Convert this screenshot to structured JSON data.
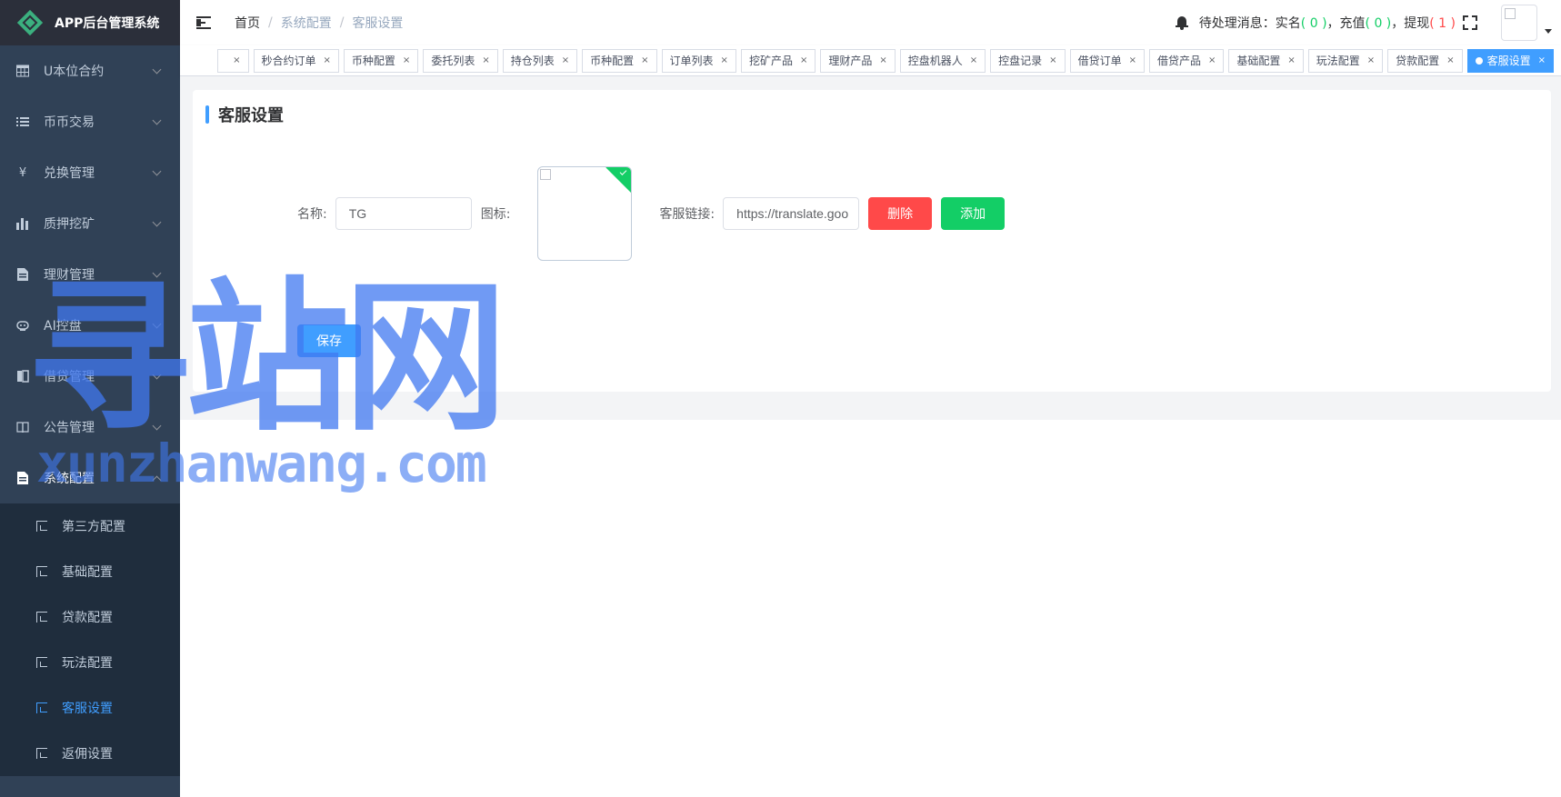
{
  "app": {
    "title": "APP后台管理系统"
  },
  "sidebar": {
    "items": [
      {
        "label": "U本位合约",
        "icon": "table-icon"
      },
      {
        "label": "币币交易",
        "icon": "list-icon"
      },
      {
        "label": "兑换管理",
        "icon": "yen-icon"
      },
      {
        "label": "质押挖矿",
        "icon": "bar-chart-icon"
      },
      {
        "label": "理财管理",
        "icon": "document-icon"
      },
      {
        "label": "AI控盘",
        "icon": "robot-icon"
      },
      {
        "label": "借贷管理",
        "icon": "book-icon"
      },
      {
        "label": "公告管理",
        "icon": "book-open-icon"
      },
      {
        "label": "系统配置",
        "icon": "document-icon"
      }
    ],
    "submenu": [
      {
        "label": "第三方配置"
      },
      {
        "label": "基础配置"
      },
      {
        "label": "贷款配置"
      },
      {
        "label": "玩法配置"
      },
      {
        "label": "客服设置"
      },
      {
        "label": "返佣设置"
      }
    ]
  },
  "header": {
    "breadcrumb": [
      "首页",
      "系统配置",
      "客服设置"
    ],
    "separator": "/",
    "msg_label": "待处理消息：",
    "realname_label": "实名",
    "realname_count": "( 0 )",
    "recharge_label": "充值",
    "recharge_count": "( 0 )",
    "withdraw_label": "提现",
    "withdraw_count": "( 1 )",
    "comma": "，"
  },
  "tags": [
    {
      "label": ""
    },
    {
      "label": "秒合约订单"
    },
    {
      "label": "币种配置"
    },
    {
      "label": "委托列表"
    },
    {
      "label": "持仓列表"
    },
    {
      "label": "币种配置"
    },
    {
      "label": "订单列表"
    },
    {
      "label": "挖矿产品"
    },
    {
      "label": "理财产品"
    },
    {
      "label": "控盘机器人"
    },
    {
      "label": "控盘记录"
    },
    {
      "label": "借贷订单"
    },
    {
      "label": "借贷产品"
    },
    {
      "label": "基础配置"
    },
    {
      "label": "玩法配置"
    },
    {
      "label": "贷款配置"
    },
    {
      "label": "客服设置"
    }
  ],
  "tag_close": "×",
  "page": {
    "title": "客服设置",
    "name_label": "名称:",
    "name_value": "TG",
    "icon_label": "图标:",
    "link_label": "客服链接:",
    "link_value": "https://translate.goo",
    "delete_button": "删除",
    "add_button": "添加",
    "save_button": "保存"
  },
  "watermark": {
    "cn": "寻站网",
    "en": "xunzhanwang.com"
  },
  "colors": {
    "primary": "#409eff",
    "danger": "#ff4949",
    "success": "#13ce66",
    "sidebar_bg": "#304156"
  }
}
